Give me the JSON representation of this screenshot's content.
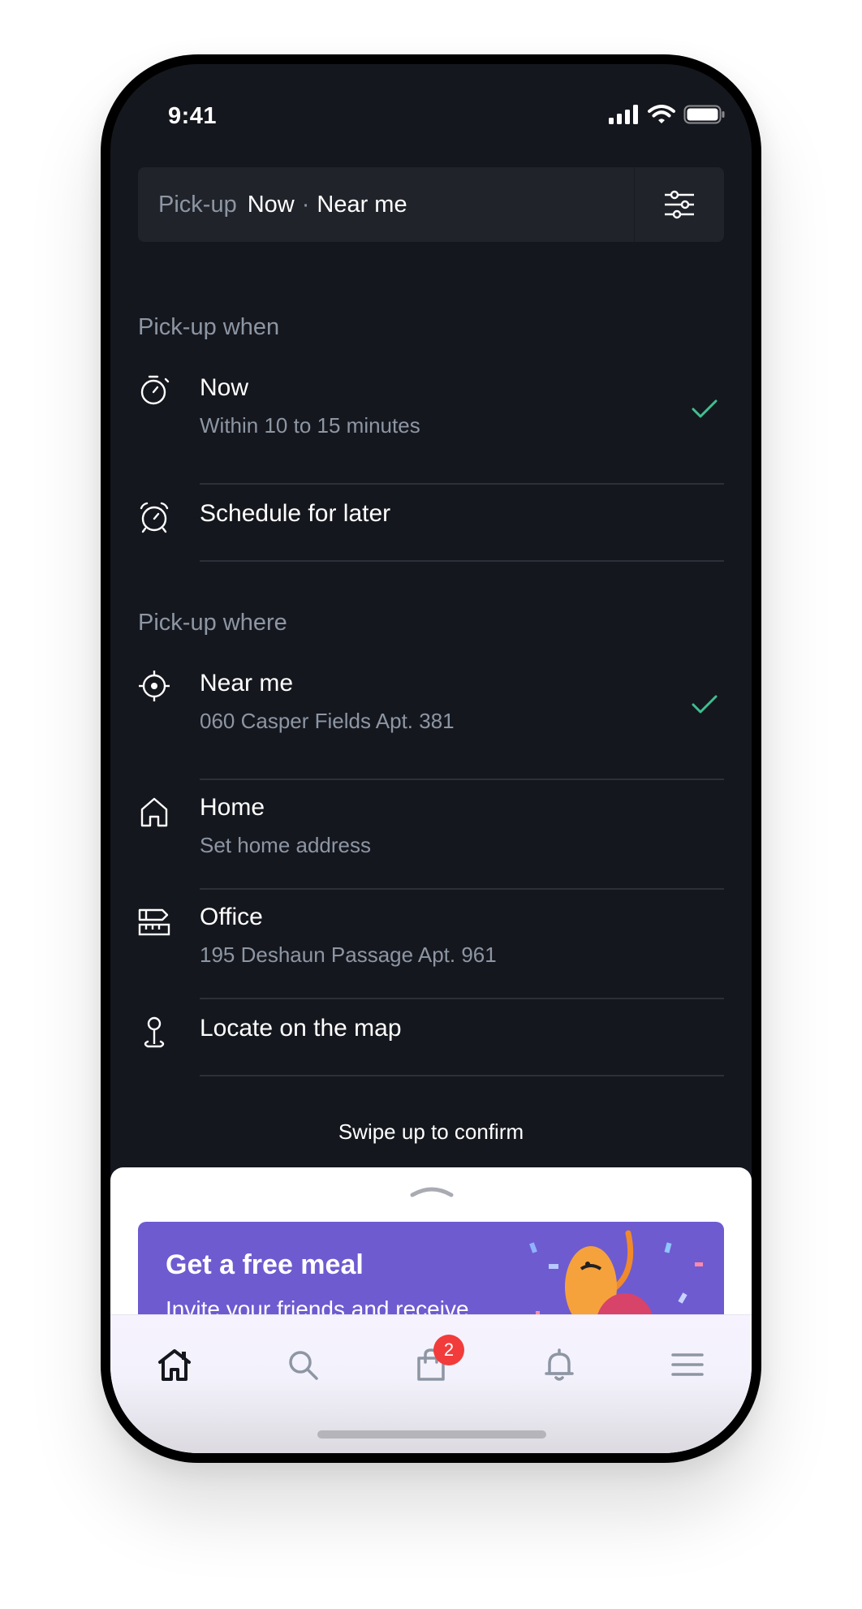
{
  "status_bar": {
    "time": "9:41"
  },
  "search_bar": {
    "mode": "Pick-up",
    "when": "Now",
    "separator": "·",
    "where": "Near me"
  },
  "pickup_when": {
    "label": "Pick-up when",
    "options": [
      {
        "title": "Now",
        "subtitle": "Within 10 to 15 minutes",
        "icon": "stopwatch-icon",
        "selected": true
      },
      {
        "title": "Schedule for later",
        "icon": "alarm-clock-icon",
        "selected": false
      }
    ]
  },
  "pickup_where": {
    "label": "Pick-up where",
    "options": [
      {
        "title": "Near me",
        "subtitle": "060 Casper Fields Apt. 381",
        "icon": "crosshair-icon",
        "selected": true
      },
      {
        "title": "Home",
        "subtitle": "Set home address",
        "icon": "house-icon",
        "selected": false
      },
      {
        "title": "Office",
        "subtitle": "195 Deshaun Passage Apt. 961",
        "icon": "office-icon",
        "selected": false
      },
      {
        "title": "Locate on the map",
        "icon": "map-pin-icon",
        "selected": false
      }
    ]
  },
  "swipe_hint": "Swipe up to confirm",
  "promo": {
    "title": "Get a free meal",
    "subtitle": "Invite your friends and receive"
  },
  "tab_bar": {
    "tabs": [
      {
        "name": "home",
        "icon": "home-icon",
        "active": true
      },
      {
        "name": "search",
        "icon": "search-icon",
        "active": false
      },
      {
        "name": "bag",
        "icon": "shopping-bag-icon",
        "active": false,
        "badge": "2"
      },
      {
        "name": "notifications",
        "icon": "bell-icon",
        "active": false
      },
      {
        "name": "menu",
        "icon": "menu-icon",
        "active": false
      }
    ]
  },
  "colors": {
    "background": "#15171e",
    "accent_check": "#3fbf8f",
    "promo": "#6e5bd0",
    "badge": "#f23b3b",
    "muted_text": "#8d96a3"
  }
}
